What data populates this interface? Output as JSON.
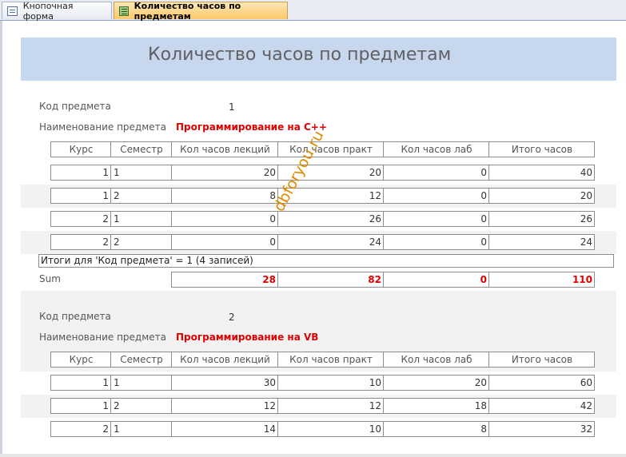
{
  "tabs": [
    {
      "label": "Кнопочная форма",
      "icon": "form-icon"
    },
    {
      "label": "Количество часов по предметам",
      "icon": "report-icon"
    }
  ],
  "report": {
    "title": "Количество часов по предметам",
    "labels": {
      "code": "Код предмета",
      "name": "Наименование предмета",
      "sum": "Sum"
    },
    "columns": [
      "Курс",
      "Семестр",
      "Кол часов лекций",
      "Кол часов практ",
      "Кол часов лаб",
      "Итого часов"
    ],
    "groups": [
      {
        "code": "1",
        "name": "Программирование на С++",
        "rows": [
          [
            "1",
            "1",
            "20",
            "20",
            "0",
            "40"
          ],
          [
            "1",
            "2",
            "8",
            "12",
            "0",
            "20"
          ],
          [
            "2",
            "1",
            "0",
            "26",
            "0",
            "26"
          ],
          [
            "2",
            "2",
            "0",
            "24",
            "0",
            "24"
          ]
        ],
        "summary": "Итоги для 'Код предмета' =  1 (4 записей)",
        "totals": [
          "28",
          "82",
          "0",
          "110"
        ]
      },
      {
        "code": "2",
        "name": "Программирование на VB",
        "rows": [
          [
            "1",
            "1",
            "30",
            "10",
            "20",
            "60"
          ],
          [
            "1",
            "2",
            "12",
            "12",
            "18",
            "42"
          ],
          [
            "2",
            "1",
            "14",
            "10",
            "8",
            "32"
          ]
        ]
      }
    ]
  },
  "watermark": "dbforyou.ru",
  "colors": {
    "header_band": "#c7d7ee",
    "active_tab": "#fbc868",
    "accent_red": "#e00000",
    "watermark": "#e08a00"
  }
}
